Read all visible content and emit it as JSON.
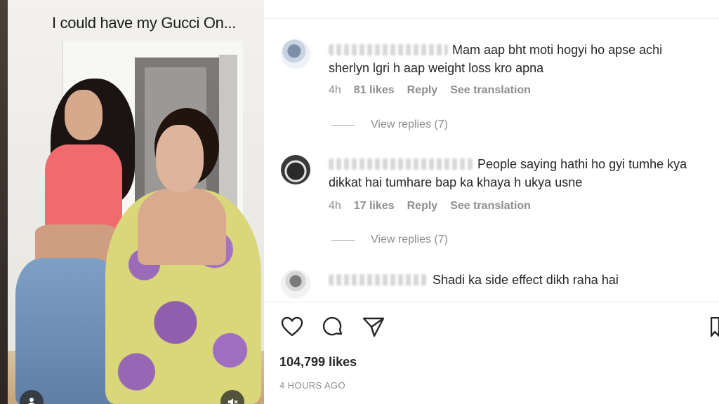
{
  "video": {
    "caption": "I could have my Gucci On..."
  },
  "comments": [
    {
      "text": "Mam aap bht moti hogyi ho apse achi sherlyn lgri h aap weight loss kro apna",
      "time": "4h",
      "likes": "81 likes",
      "reply": "Reply",
      "translate": "See translation",
      "view_replies": "View replies (7)"
    },
    {
      "text": "People saying hathi ho gyi tumhe kya dikkat hai tumhare bap ka khaya h ukya usne",
      "time": "4h",
      "likes": "17 likes",
      "reply": "Reply",
      "translate": "See translation",
      "view_replies": "View replies (7)"
    },
    {
      "text": "Shadi ka side effect dikh raha hai"
    }
  ],
  "post": {
    "likes": "104,799 likes",
    "timestamp": "4 HOURS AGO"
  },
  "icons": {
    "like": "heart-icon",
    "comment": "comment-icon",
    "share": "paper-plane-icon",
    "save": "bookmark-icon",
    "mute": "speaker-muted-icon",
    "tag": "user-tag-icon"
  }
}
